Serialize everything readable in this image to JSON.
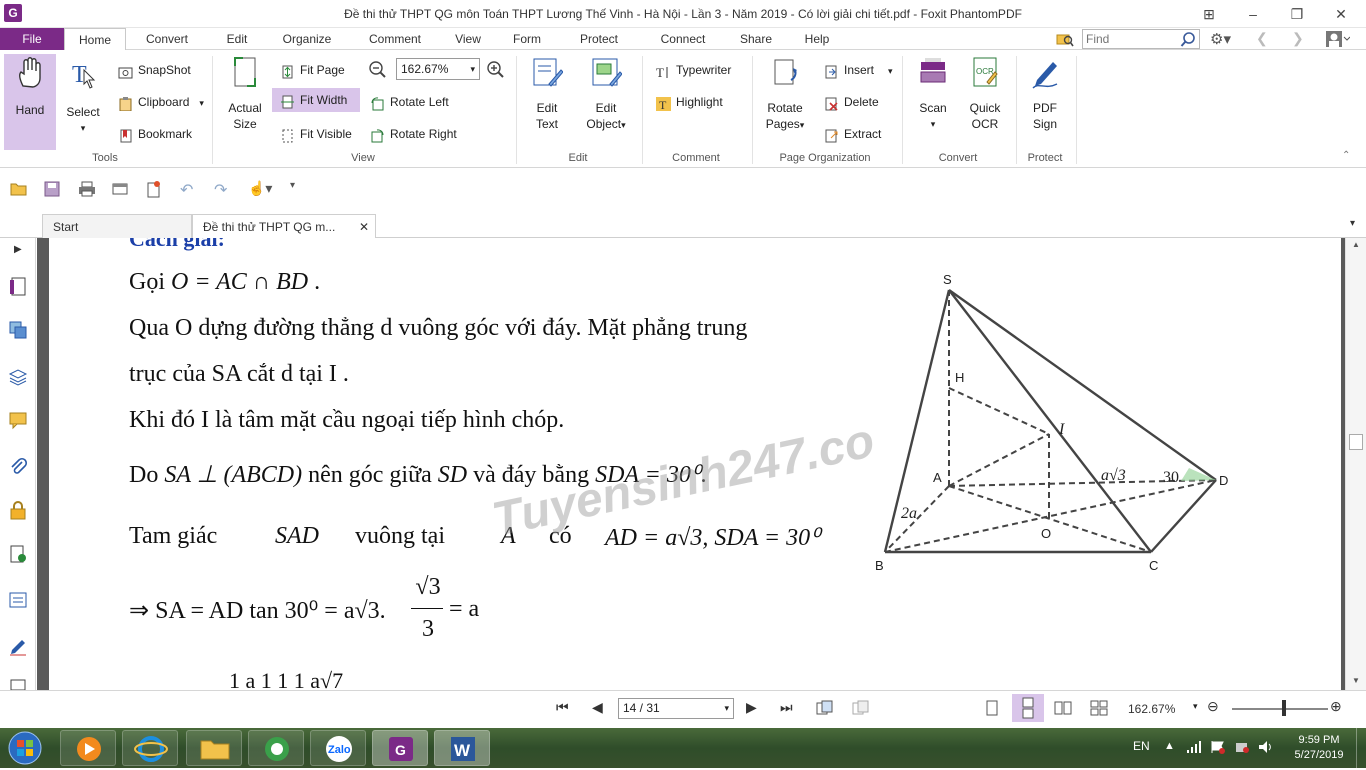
{
  "window": {
    "app_logo": "G",
    "title": "Đề thi thử THPT QG môn Toán THPT Lương Thế Vinh - Hà Nội - Lần 3 - Năm 2019 - Có lời giải chi tiết.pdf - Foxit PhantomPDF"
  },
  "menu": {
    "file": "File",
    "tabs": [
      "Home",
      "Convert",
      "Edit",
      "Organize",
      "Comment",
      "View",
      "Form",
      "Protect",
      "Connect",
      "Share",
      "Help"
    ],
    "find_placeholder": "Find"
  },
  "ribbon": {
    "tools": {
      "hand": "Hand",
      "select": "Select",
      "snapshot": "SnapShot",
      "clipboard": "Clipboard",
      "bookmark": "Bookmark",
      "group": "Tools"
    },
    "view": {
      "actual_size_1": "Actual",
      "actual_size_2": "Size",
      "fit_page": "Fit Page",
      "fit_width": "Fit Width",
      "fit_visible": "Fit Visible",
      "zoom_value": "162.67%",
      "rotate_left": "Rotate Left",
      "rotate_right": "Rotate Right",
      "group": "View"
    },
    "edit": {
      "edit_text_1": "Edit",
      "edit_text_2": "Text",
      "edit_object_1": "Edit",
      "edit_object_2": "Object",
      "group": "Edit"
    },
    "comment": {
      "typewriter": "Typewriter",
      "highlight": "Highlight",
      "group": "Comment"
    },
    "page_org": {
      "rotate_pages_1": "Rotate",
      "rotate_pages_2": "Pages",
      "insert": "Insert",
      "delete": "Delete",
      "extract": "Extract",
      "group": "Page Organization"
    },
    "convert": {
      "scan": "Scan",
      "quick_ocr_1": "Quick",
      "quick_ocr_2": "OCR",
      "group": "Convert"
    },
    "protect": {
      "pdf_sign_1": "PDF",
      "pdf_sign_2": "Sign",
      "group": "Protect"
    }
  },
  "doc_tabs": {
    "start": "Start",
    "current": "Đề thi thử THPT QG m..."
  },
  "document": {
    "heading_partial": "Cách giải:",
    "line1_a": "Gọi ",
    "line1_math": "O = AC ∩ BD",
    "line1_end": " .",
    "line2": "Qua  O  dựng đường thẳng  d  vuông góc với đáy. Mặt phẳng trung",
    "line3": "trục của  SA  cắt  d  tại  I .",
    "line4": "Khi đó  I  là tâm mặt cầu ngoại tiếp hình chóp.",
    "line5_a": "Do ",
    "line5_math1": "SA ⊥ (ABCD)",
    "line5_b": " nên góc giữa ",
    "line5_math2": "SD",
    "line5_c": " và đáy bằng ",
    "line5_math3": "SDA = 30⁰",
    "line5_end": ".",
    "line6_a": "Tam   giác",
    "line6_math1": "SAD",
    "line6_b": "vuông   tại",
    "line6_math2": "A",
    "line6_c": "có",
    "line6_math3": "AD = a√3, SDA = 30⁰",
    "line7": "⇒ SA = AD tan 30⁰ = a√3.",
    "line7_num": "√3",
    "line7_den": "3",
    "line7_end": "= a",
    "line8_partial": "1          a                1          1                              1                         a√7",
    "watermark": "Tuyensinh247.co",
    "figure": {
      "S": "S",
      "H": "H",
      "I": "I",
      "A": "A",
      "D": "D",
      "B": "B",
      "C": "C",
      "O": "O",
      "label_a3": "a√3",
      "label_2a": "2a",
      "label_30": "30"
    }
  },
  "status": {
    "page": "14 / 31",
    "zoom": "162.67%"
  },
  "taskbar": {
    "lang": "EN",
    "time": "9:59 PM",
    "date": "5/27/2019"
  },
  "colors": {
    "accent": "#7b2a87",
    "heading": "#1b3fa8",
    "highlight_button": "#d9c5ea"
  }
}
